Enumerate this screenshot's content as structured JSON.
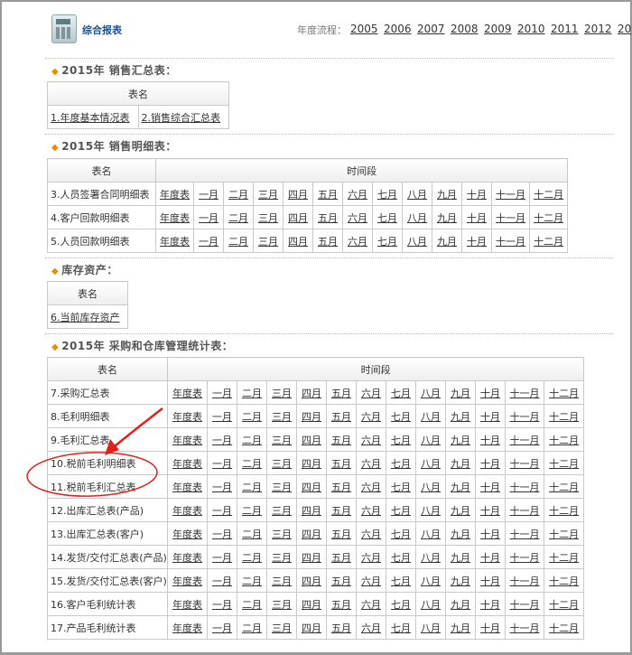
{
  "header": {
    "title": "综合报表",
    "year_label": "年度流程：",
    "years": [
      "2005",
      "2006",
      "2007",
      "2008",
      "2009",
      "2010",
      "2011",
      "2012",
      "20"
    ]
  },
  "sections": {
    "sales_summary": {
      "title": "2015年 销售汇总表：",
      "col_name": "表名",
      "items": [
        "1.年度基本情况表",
        "2.销售综合汇总表"
      ]
    },
    "sales_detail": {
      "title": "2015年 销售明细表：",
      "col_name": "表名",
      "col_period": "时间段",
      "rows": [
        "3.人员签署合同明细表",
        "4.客户回款明细表",
        "5.人员回款明细表"
      ]
    },
    "inventory": {
      "title": "库存资产：",
      "col_name": "表名",
      "items": [
        "6.当前库存资产"
      ]
    },
    "purchase": {
      "title": "2015年 采购和仓库管理统计表：",
      "col_name": "表名",
      "col_period": "时间段",
      "rows": [
        "7.采购汇总表",
        "8.毛利明细表",
        "9.毛利汇总表",
        "10.税前毛利明细表",
        "11.税前毛利汇总表",
        "12.出库汇总表(产品)",
        "13.出库汇总表(客户)",
        "14.发货/交付汇总表(产品)",
        "15.发货/交付汇总表(客户)",
        "16.客户毛利统计表",
        "17.产品毛利统计表"
      ]
    }
  },
  "periods": [
    "年度表",
    "一月",
    "二月",
    "三月",
    "四月",
    "五月",
    "六月",
    "七月",
    "八月",
    "九月",
    "十月",
    "十一月",
    "十二月"
  ],
  "annotation": {
    "color": "#e0201a",
    "icon": "red-arrow-and-ellipse"
  }
}
